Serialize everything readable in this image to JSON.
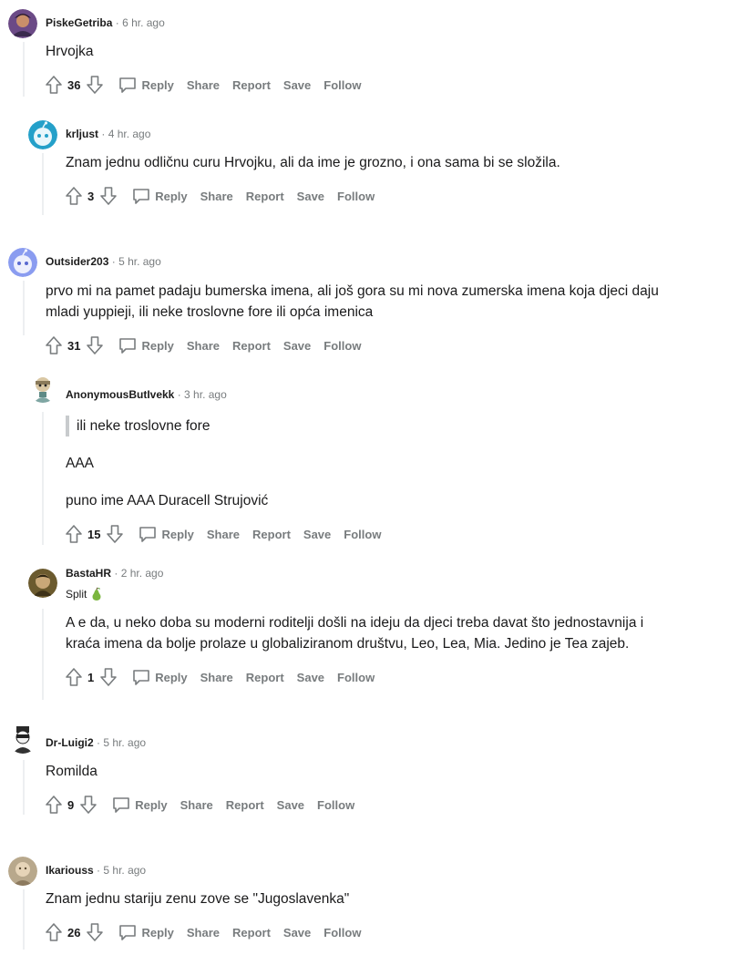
{
  "actions": {
    "reply": "Reply",
    "share": "Share",
    "report": "Report",
    "save": "Save",
    "follow": "Follow"
  },
  "comments": [
    {
      "user": "PiskeGetriba",
      "time": "6 hr. ago",
      "text": "Hrvojka",
      "score": "36"
    },
    {
      "user": "krljust",
      "time": "4 hr. ago",
      "text": "Znam jednu odličnu curu Hrvojku, ali da ime je grozno, i ona sama bi se složila.",
      "score": "3"
    },
    {
      "user": "Outsider203",
      "time": "5 hr. ago",
      "text_line1": "prvo mi na pamet padaju bumerska imena, ali još gora su mi nova zumerska imena koja djeci daju",
      "text_line2": "mladi yuppieji, ili neke troslovne fore ili opća imenica",
      "score": "31"
    },
    {
      "user": "AnonymousButIvekk",
      "time": "3 hr. ago",
      "quote": "ili neke troslovne fore",
      "para1": "AAA",
      "para2": "puno ime AAA Duracell Strujović",
      "score": "15"
    },
    {
      "user": "BastaHR",
      "time": "2 hr. ago",
      "flair": "Split",
      "text_line1": "A e da, u neko doba su moderni roditelji došli na ideju da djeci treba davat što jednostavnija i",
      "text_line2": "kraća imena da bolje prolaze u globaliziranom društvu, Leo, Lea, Mia. Jedino je Tea zajeb.",
      "score": "1"
    },
    {
      "user": "Dr-Luigi2",
      "time": "5 hr. ago",
      "text": "Romilda",
      "score": "9"
    },
    {
      "user": "Ikariouss",
      "time": "5 hr. ago",
      "text": "Znam jednu stariju zenu zove se \"Jugoslavenka\"",
      "score": "26"
    }
  ]
}
